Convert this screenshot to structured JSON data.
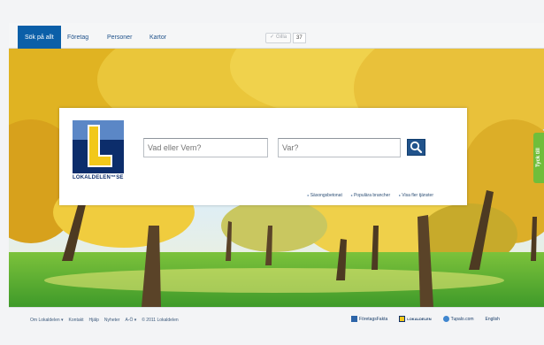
{
  "tabs": [
    {
      "label": "Sök på allt",
      "active": true
    },
    {
      "label": "Företag",
      "active": false
    },
    {
      "label": "Personer",
      "active": false
    },
    {
      "label": "Kartor",
      "active": false
    }
  ],
  "like": {
    "label": "Gilla",
    "count": "37"
  },
  "search": {
    "logo_text": "LOKALDELEN™SE",
    "what_placeholder": "Vad eller Vem?",
    "where_placeholder": "Var?",
    "links": [
      "Säsongsbetonat",
      "Populära brancher",
      "Visa fler tjänster"
    ]
  },
  "feedback_label": "Tyck till",
  "footer": {
    "links": [
      "Om Lokaldelen",
      "Kontakt",
      "Hjälp",
      "Nyheter",
      "A-Ö",
      "© 2011 Lokaldelen"
    ],
    "partners": [
      "FöretagsFakta",
      "LOKALDELEN",
      "Tupalo.com",
      "English"
    ]
  },
  "colors": {
    "accent": "#0b5fa8",
    "logo_blue": "#0c2d6b",
    "logo_yellow": "#f2c81a",
    "feedback_green": "#6fbe3b"
  },
  "icons": {
    "search": "search-icon",
    "like": "thumb-up-icon"
  }
}
